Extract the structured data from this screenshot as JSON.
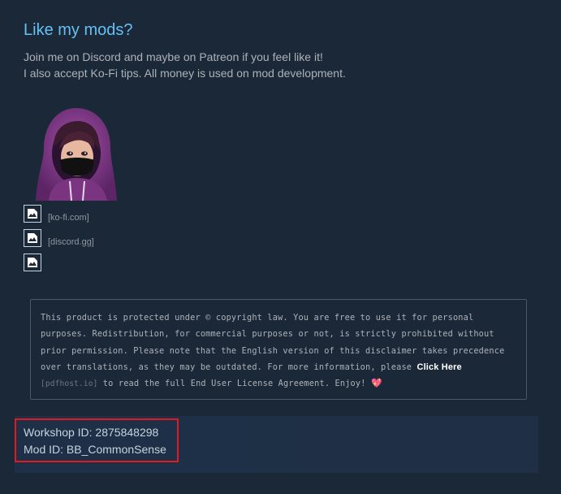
{
  "heading": "Like my mods?",
  "intro": {
    "line1": "Join me on Discord and maybe on Patreon if you feel like it!",
    "line2": "I also accept Ko-Fi tips. All money is used on mod development."
  },
  "links": [
    {
      "text": "[ko-fi.com]",
      "icon": "broken-image-icon"
    },
    {
      "text": "[discord.gg]",
      "icon": "broken-image-icon"
    },
    {
      "text": "",
      "icon": "broken-image-icon"
    }
  ],
  "disclaimer": {
    "text_before": "This product is protected under © copyright law. You are free to use it for personal purposes. Redistribution, for commercial purposes or not, is strictly prohibited without prior permission. Please note that the English version of this disclaimer takes precedence over translations, as they may be outdated. For more information, please ",
    "link_label": "Click Here",
    "link_host": "[pdfhost.io]",
    "text_after": " to read the full End User License Agreement. Enjoy!",
    "emoji": "💖"
  },
  "workshop": {
    "workshop_id": "Workshop ID: 2875848298",
    "mod_id": "Mod ID: BB_CommonSense"
  },
  "colors": {
    "background": "#1b2838",
    "heading": "#66c0f4",
    "highlight_border": "#e2191f"
  }
}
